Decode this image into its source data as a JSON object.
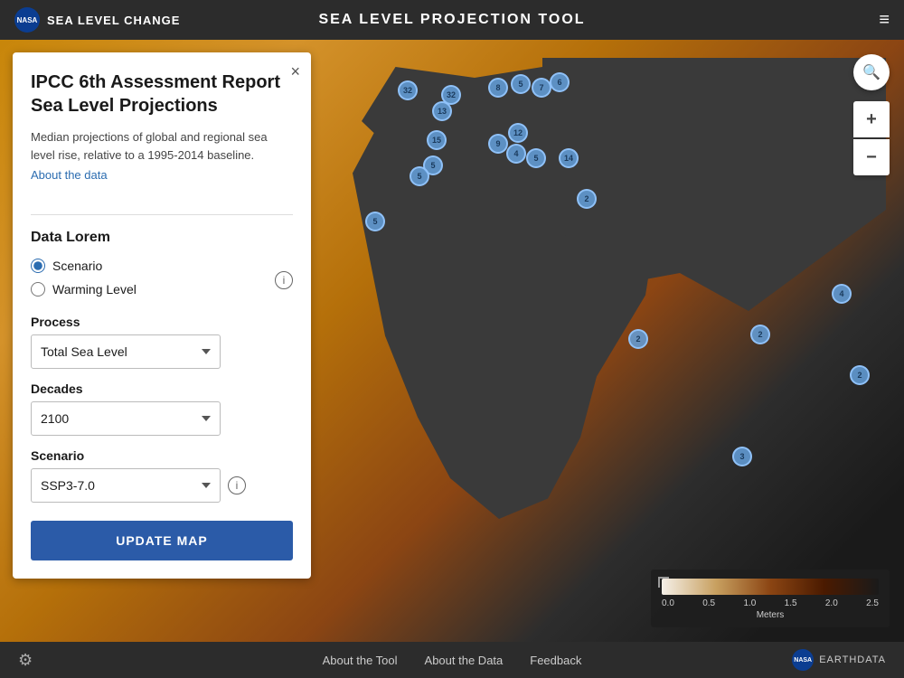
{
  "app": {
    "site_title": "SEA LEVEL CHANGE",
    "page_title": "SEA LEVEL PROJECTION TOOL"
  },
  "panel": {
    "title": "IPCC 6th Assessment Report Sea Level Projections",
    "description": "Median projections of global and regional sea level rise, relative to a 1995-2014 baseline.",
    "about_link": "About the data",
    "data_section_title": "Data Lorem",
    "radio_scenario": "Scenario",
    "radio_warming": "Warming Level",
    "process_label": "Process",
    "process_value": "Total Sea Level",
    "decades_label": "Decades",
    "decades_value": "2100",
    "scenario_label": "Scenario",
    "scenario_value": "SSP3-7.0",
    "update_btn": "UPDATE MAP",
    "close_btn": "×"
  },
  "map": {
    "markers": [
      {
        "id": 1,
        "value": "32",
        "top": "45",
        "left": "440",
        "size": "normal"
      },
      {
        "id": 2,
        "value": "32",
        "top": "50",
        "left": "488",
        "size": "normal"
      },
      {
        "id": 3,
        "value": "8",
        "top": "42",
        "left": "540",
        "size": "normal"
      },
      {
        "id": 4,
        "value": "5",
        "top": "38",
        "left": "565",
        "size": "normal"
      },
      {
        "id": 5,
        "value": "7",
        "top": "42",
        "left": "588",
        "size": "normal"
      },
      {
        "id": 6,
        "value": "6",
        "top": "36",
        "left": "608",
        "size": "normal"
      },
      {
        "id": 7,
        "value": "13",
        "top": "68",
        "left": "478",
        "size": "normal"
      },
      {
        "id": 8,
        "value": "15",
        "top": "100",
        "left": "472",
        "size": "normal"
      },
      {
        "id": 9,
        "value": "12",
        "top": "92",
        "left": "562",
        "size": "normal"
      },
      {
        "id": 10,
        "value": "9",
        "top": "104",
        "left": "540",
        "size": "normal"
      },
      {
        "id": 11,
        "value": "4",
        "top": "115",
        "left": "560",
        "size": "normal"
      },
      {
        "id": 12,
        "value": "14",
        "top": "120",
        "left": "618",
        "size": "normal"
      },
      {
        "id": 13,
        "value": "5",
        "top": "120",
        "left": "582",
        "size": "normal"
      },
      {
        "id": 14,
        "value": "5",
        "top": "128",
        "left": "468",
        "size": "normal"
      },
      {
        "id": 15,
        "value": "5",
        "top": "140",
        "left": "453",
        "size": "normal"
      },
      {
        "id": 16,
        "value": "2",
        "top": "165",
        "left": "638",
        "size": "normal"
      },
      {
        "id": 17,
        "value": "5",
        "top": "190",
        "left": "404",
        "size": "normal"
      },
      {
        "id": 18,
        "value": "2",
        "top": "320",
        "left": "695",
        "size": "normal"
      },
      {
        "id": 19,
        "value": "3",
        "top": "450",
        "left": "810",
        "size": "normal"
      },
      {
        "id": 20,
        "value": "4",
        "top": "270",
        "left": "920",
        "size": "normal"
      },
      {
        "id": 21,
        "value": "2",
        "top": "360",
        "left": "940",
        "size": "normal"
      },
      {
        "id": 22,
        "value": "2",
        "top": "315",
        "left": "830",
        "size": "normal"
      }
    ],
    "legend": {
      "title": "Meters",
      "min": "0.0",
      "v1": "0.5",
      "v2": "1.0",
      "v3": "1.5",
      "v4": "2.0",
      "max": "2.5"
    }
  },
  "footer": {
    "about_tool": "About the Tool",
    "about_data": "About the Data",
    "feedback": "Feedback",
    "earthdata": "EARTHDATA"
  },
  "icons": {
    "menu": "≡",
    "close": "×",
    "search": "🔍",
    "zoom_in": "+",
    "zoom_out": "−",
    "settings": "⚙",
    "info": "i"
  }
}
